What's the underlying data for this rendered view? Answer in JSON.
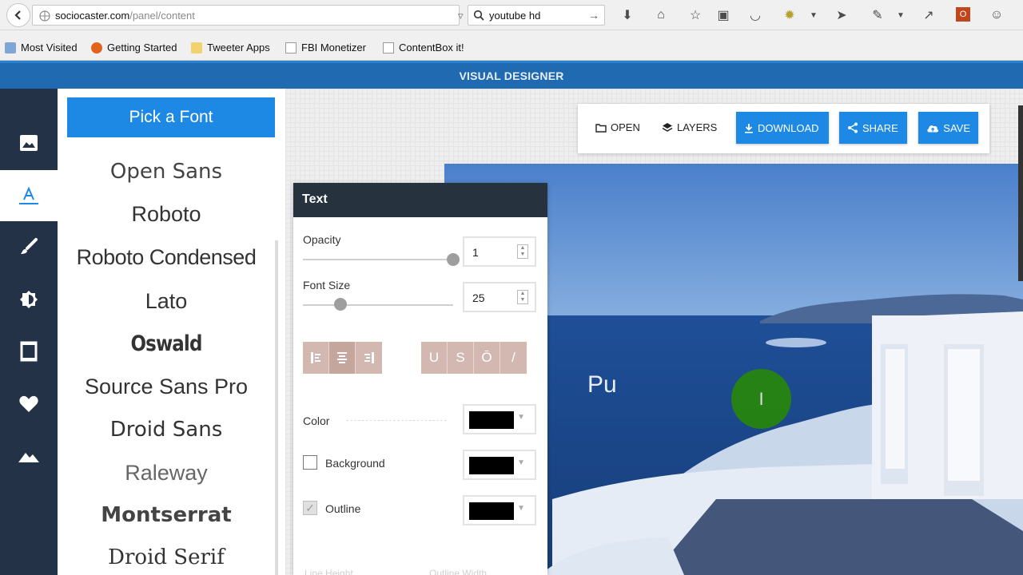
{
  "browser": {
    "url_host": "sociocaster.com",
    "url_path": "/panel/content",
    "search_query": "youtube hd",
    "bookmarks": [
      "Most Visited",
      "Getting Started",
      "Tweeter Apps",
      "FBI Monetizer",
      "ContentBox it!"
    ]
  },
  "app": {
    "title": "VISUAL DESIGNER"
  },
  "rail": [
    "image-icon",
    "text-icon",
    "brush-icon",
    "adjust-icon",
    "frame-icon",
    "heart-icon",
    "landscape-icon"
  ],
  "font_panel": {
    "button_label": "Pick a Font",
    "fonts": [
      "Open Sans",
      "Roboto",
      "Roboto Condensed",
      "Lato",
      "Oswald",
      "Source Sans Pro",
      "Droid Sans",
      "Raleway",
      "Montserrat",
      "Droid Serif"
    ]
  },
  "toolbar": {
    "open": "OPEN",
    "layers": "LAYERS",
    "download": "DOWNLOAD",
    "share": "SHARE",
    "save": "SAVE"
  },
  "canvas": {
    "text": "Pu"
  },
  "text_panel": {
    "title": "Text",
    "opacity_label": "Opacity",
    "opacity_value": "1",
    "font_size_label": "Font Size",
    "font_size_value": "25",
    "opacity_level": 1.0,
    "font_size_level": 0.25,
    "align_buttons": [
      "left",
      "center",
      "right"
    ],
    "style_buttons": [
      "U",
      "S",
      "Ō",
      "/"
    ],
    "color_label": "Color",
    "background_label": "Background",
    "outline_label": "Outline",
    "swatch_color": "#000000",
    "background_checked": false,
    "outline_checked": true,
    "faded_labels": [
      "Line Height",
      "Outline Width"
    ]
  },
  "colors": {
    "accent": "#1e88e5",
    "rail": "#233246",
    "header": "#1f6ab0",
    "panel_header": "#26333f"
  }
}
